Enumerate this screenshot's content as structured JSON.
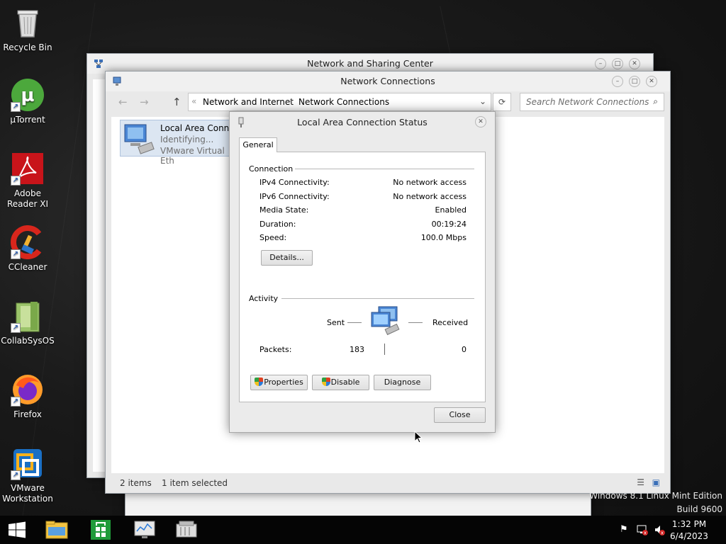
{
  "desktop": {
    "icons": [
      {
        "label": "Recycle Bin"
      },
      {
        "label": "µTorrent"
      },
      {
        "label": "Adobe Reader XI"
      },
      {
        "label": "CCleaner"
      },
      {
        "label": "CollabSysOS"
      },
      {
        "label": "Firefox"
      },
      {
        "label": "VMware Workstation"
      }
    ],
    "watermark_line1": "Windows 8.1 Linux Mint Edition",
    "watermark_line2": "Build 9600"
  },
  "nsc_window": {
    "title": "Network and Sharing Center"
  },
  "nc_window": {
    "title": "Network Connections",
    "breadcrumb": [
      "Network and Internet",
      "Network Connections"
    ],
    "search_placeholder": "Search Network Connections",
    "adapter": {
      "name": "Local Area Connec",
      "status": "Identifying...",
      "device": "VMware Virtual Eth"
    },
    "status_items": "2 items",
    "status_selected": "1 item selected"
  },
  "dialog": {
    "title": "Local Area Connection Status",
    "tab_general": "General",
    "connection_heading": "Connection",
    "rows": [
      {
        "label": "IPv4 Connectivity:",
        "value": "No network access"
      },
      {
        "label": "IPv6 Connectivity:",
        "value": "No network access"
      },
      {
        "label": "Media State:",
        "value": "Enabled"
      },
      {
        "label": "Duration:",
        "value": "00:19:24"
      },
      {
        "label": "Speed:",
        "value": "100.0 Mbps"
      }
    ],
    "details_button": "Details...",
    "activity_heading": "Activity",
    "sent_label": "Sent",
    "received_label": "Received",
    "packets_label": "Packets:",
    "packets_sent": "183",
    "packets_received": "0",
    "properties_button": "Properties",
    "disable_button": "Disable",
    "diagnose_button": "Diagnose",
    "close_button": "Close"
  },
  "taskbar": {
    "time": "1:32 PM",
    "date": "6/4/2023"
  },
  "colors": {
    "utorrent": "#4ca83c",
    "adobe": "#d01c1c",
    "firefox": "#ff7a1a",
    "vmware": "#1a6fc4",
    "store_green": "#1f9b3a"
  }
}
